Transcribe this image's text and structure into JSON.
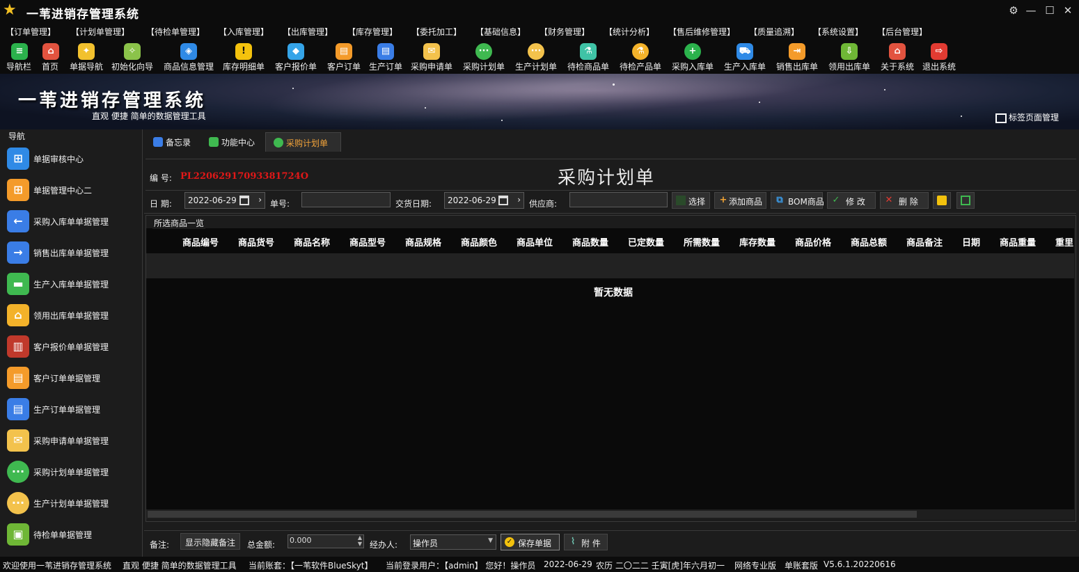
{
  "app": {
    "title": "一苇进销存管理系统"
  },
  "menu": [
    "【订单管理】",
    "【计划单管理】",
    "【待检单管理】",
    "【入库管理】",
    "【出库管理】",
    "【库存管理】",
    "【委托加工】",
    "【基础信息】",
    "【财务管理】",
    "【统计分析】",
    "【售后维修管理】",
    "【质量追溯】",
    "【系统设置】",
    "【后台管理】"
  ],
  "toolbar": [
    {
      "label": "导航栏",
      "icon": "menu-icon",
      "color": "#2bb24c"
    },
    {
      "label": "首页",
      "icon": "home-icon",
      "color": "#e2533f"
    },
    {
      "label": "单据导航",
      "icon": "compass-icon",
      "color": "#f2c12e"
    },
    {
      "label": "初始化向导",
      "icon": "wand-icon",
      "color": "#8bc34a"
    },
    {
      "label": "商品信息管理",
      "icon": "cubes-icon",
      "color": "#2f8ae6"
    },
    {
      "label": "库存明细单",
      "icon": "warning-icon",
      "color": "#f4c20d"
    },
    {
      "label": "客户报价单",
      "icon": "tag-icon",
      "color": "#35a4e8"
    },
    {
      "label": "客户订单",
      "icon": "document-icon",
      "color": "#f49b2a"
    },
    {
      "label": "生产订单",
      "icon": "document-icon",
      "color": "#3a7de6"
    },
    {
      "label": "采购申请单",
      "icon": "envelope-icon",
      "color": "#f3c24c"
    },
    {
      "label": "采购计划单",
      "icon": "chat-icon",
      "color": "#3fb950"
    },
    {
      "label": "生产计划单",
      "icon": "chat-icon",
      "color": "#f3c24c"
    },
    {
      "label": "待检商品单",
      "icon": "flask-icon",
      "color": "#3fc3a6"
    },
    {
      "label": "待检产品单",
      "icon": "flask-icon",
      "color": "#f3b22a"
    },
    {
      "label": "采购入库单",
      "icon": "plus-icon",
      "color": "#2bb24c"
    },
    {
      "label": "生产入库单",
      "icon": "cart-icon",
      "color": "#2f8ae6"
    },
    {
      "label": "销售出库单",
      "icon": "export-icon",
      "color": "#f49b2a"
    },
    {
      "label": "领用出库单",
      "icon": "download-icon",
      "color": "#6fb736"
    },
    {
      "label": "关于系统",
      "icon": "house-icon",
      "color": "#e2533f"
    },
    {
      "label": "退出系统",
      "icon": "exit-icon",
      "color": "#e23b32"
    }
  ],
  "banner": {
    "title": "一苇进销存管理系统",
    "subtitle": "直观 便捷 简单的数据管理工具",
    "tab_manage": "标签页面管理"
  },
  "sidebar": {
    "title": "导航",
    "items": [
      {
        "label": "单据审核中心",
        "icon": "grid-icon",
        "color": "#2f8ae6"
      },
      {
        "label": "单据管理中心二",
        "icon": "grid-icon",
        "color": "#f49b2a"
      },
      {
        "label": "采购入库单单据管理",
        "icon": "arrow-left-icon",
        "color": "#3a7de6"
      },
      {
        "label": "销售出库单单据管理",
        "icon": "arrow-right-icon",
        "color": "#3a7de6"
      },
      {
        "label": "生产入库单单据管理",
        "icon": "folder-icon",
        "color": "#3fb950"
      },
      {
        "label": "领用出库单单据管理",
        "icon": "house-icon",
        "color": "#f3b22a"
      },
      {
        "label": "客户报价单单据管理",
        "icon": "books-icon",
        "color": "#c0392b"
      },
      {
        "label": "客户订单单据管理",
        "icon": "document-icon",
        "color": "#f49b2a"
      },
      {
        "label": "生产订单单据管理",
        "icon": "document-icon",
        "color": "#3a7de6"
      },
      {
        "label": "采购申请单单据管理",
        "icon": "envelope-icon",
        "color": "#f3c24c"
      },
      {
        "label": "采购计划单单据管理",
        "icon": "chat-icon",
        "color": "#3fb950"
      },
      {
        "label": "生产计划单单据管理",
        "icon": "chat-icon",
        "color": "#f3c24c"
      },
      {
        "label": "待检单单据管理",
        "icon": "clipboard-icon",
        "color": "#6fb736"
      }
    ]
  },
  "tabs": [
    {
      "label": "备忘录",
      "icon": "memo-icon",
      "color": "#3a7de6",
      "active": false
    },
    {
      "label": "功能中心",
      "icon": "apps-icon",
      "color": "#3fb950",
      "active": false
    },
    {
      "label": "采购计划单",
      "icon": "chat-icon",
      "color": "#3fb950",
      "active": true
    }
  ],
  "form": {
    "no_label": "编  号:",
    "no_value": "PL22062917093381724O",
    "title": "采购计划单",
    "date_label": "日 期:",
    "date_value": "2022-06-29",
    "order_no_label": "单号:",
    "delivery_label": "交货日期:",
    "delivery_value": "2022-06-29",
    "supplier_label": "供应商:",
    "buttons": {
      "select": "选择",
      "add": "添加商品",
      "bom": "BOM商品",
      "edit": "修 改",
      "delete": "删 除"
    },
    "grid_title": "所选商品一览",
    "columns": [
      "商品编号",
      "商品货号",
      "商品名称",
      "商品型号",
      "商品规格",
      "商品颜色",
      "商品单位",
      "商品数量",
      "已定数量",
      "所需数量",
      "库存数量",
      "商品价格",
      "商品总额",
      "商品备注",
      "日期",
      "商品重量",
      "重里"
    ],
    "empty": "暂无数据",
    "remark_label": "备注:",
    "toggle_remark": "显示隐藏备注",
    "total_label": "总金额:",
    "total_value": "0.000",
    "handler_label": "经办人:",
    "handler_value": "操作员",
    "save": "保存单据",
    "attach": "附 件"
  },
  "status": {
    "welcome": "欢迎使用一苇进销存管理系统",
    "slogan": "直观 便捷 简单的数据管理工具",
    "account": "当前账套：【一苇软件BlueSkyt】",
    "user": "当前登录用户：【admin】 您好！操作员",
    "date": "2022-06-29",
    "lunar": "农历 二〇二二 壬寅[虎]年六月初一",
    "edition": "网络专业版",
    "mode": "单账套版",
    "version": "V5.6.1.20220616"
  }
}
